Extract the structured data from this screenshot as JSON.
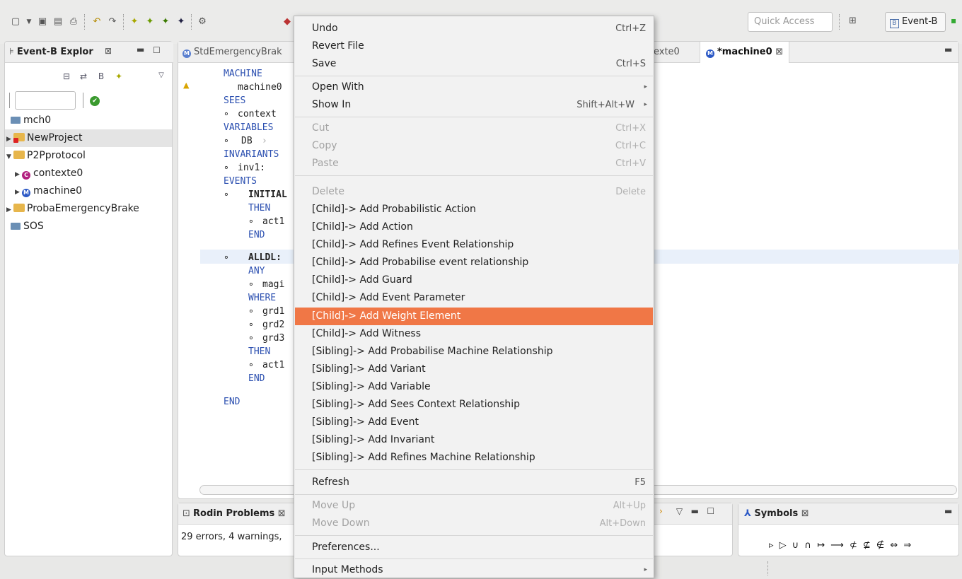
{
  "toolbar": {
    "quick_access_placeholder": "Quick Access",
    "perspective_label": "Event-B"
  },
  "explorer": {
    "title": "Event-B Explor",
    "close_glyph": "⊠",
    "tree": [
      {
        "label": "mch0",
        "type": "folder"
      },
      {
        "label": "NewProject",
        "type": "project"
      },
      {
        "label": "P2Pprotocol",
        "type": "project"
      },
      {
        "label": "contexte0",
        "type": "context"
      },
      {
        "label": "machine0",
        "type": "machine"
      },
      {
        "label": "ProbaEmergencyBrake",
        "type": "project"
      },
      {
        "label": "SOS",
        "type": "folder"
      }
    ]
  },
  "editor": {
    "tabs": [
      "StdEmergencyBrak",
      "exte0",
      "*machine0"
    ],
    "code": {
      "machine_kw": "MACHINE",
      "machine_name": "machine0",
      "sees_kw": "SEES",
      "sees_item": "context",
      "variables_kw": "VARIABLES",
      "variables_item": "DB",
      "invariants_kw": "INVARIANTS",
      "invariants_item": "inv1:",
      "events_kw": "EVENTS",
      "event1": "INITIAL",
      "then_kw": "THEN",
      "act1": "act1",
      "end_kw": "END",
      "event2": "ALLDL:",
      "any_kw": "ANY",
      "param1": "magi",
      "where_kw": "WHERE",
      "grd1": "grd1",
      "grd2": "grd2",
      "grd3": "grd3",
      "end_final": "END"
    }
  },
  "problems": {
    "title": "Rodin Problems",
    "status": "29 errors, 4 warnings,"
  },
  "symbols": {
    "title": "Symbols",
    "row": "▹ ▷ ∪ ∩ ↦ ⟶ ⊄ ⊈ ∉ ⇔ ⇒"
  },
  "context_menu": {
    "items": [
      {
        "label": "Undo",
        "shortcut": "Ctrl+Z",
        "enabled": true
      },
      {
        "label": "Revert File",
        "shortcut": "",
        "enabled": true
      },
      {
        "label": "Save",
        "shortcut": "Ctrl+S",
        "enabled": true
      },
      {
        "label": "Open With",
        "shortcut": "",
        "enabled": true,
        "submenu": true
      },
      {
        "label": "Show In",
        "shortcut": "Shift+Alt+W",
        "enabled": true,
        "submenu": true
      },
      {
        "label": "Cut",
        "shortcut": "Ctrl+X",
        "enabled": false
      },
      {
        "label": "Copy",
        "shortcut": "Ctrl+C",
        "enabled": false
      },
      {
        "label": "Paste",
        "shortcut": "Ctrl+V",
        "enabled": false
      },
      {
        "label": "Delete",
        "shortcut": "Delete",
        "enabled": false
      },
      {
        "label": "[Child]-> Add  Probabilistic Action",
        "enabled": true
      },
      {
        "label": "[Child]-> Add  Action",
        "enabled": true
      },
      {
        "label": "[Child]-> Add  Refines Event Relationship",
        "enabled": true
      },
      {
        "label": "[Child]-> Add  Probabilise event relationship",
        "enabled": true
      },
      {
        "label": "[Child]-> Add  Guard",
        "enabled": true
      },
      {
        "label": "[Child]-> Add  Event Parameter",
        "enabled": true
      },
      {
        "label": "[Child]-> Add  Weight Element",
        "enabled": true,
        "highlighted": true
      },
      {
        "label": "[Child]-> Add  Witness",
        "enabled": true
      },
      {
        "label": "[Sibling]-> Add  Probabilise Machine Relationship",
        "enabled": true
      },
      {
        "label": "[Sibling]-> Add  Variant",
        "enabled": true
      },
      {
        "label": "[Sibling]-> Add  Variable",
        "enabled": true
      },
      {
        "label": "[Sibling]-> Add  Sees Context Relationship",
        "enabled": true
      },
      {
        "label": "[Sibling]-> Add  Event",
        "enabled": true
      },
      {
        "label": "[Sibling]-> Add  Invariant",
        "enabled": true
      },
      {
        "label": "[Sibling]-> Add  Refines Machine Relationship",
        "enabled": true
      },
      {
        "label": "Refresh",
        "shortcut": "F5",
        "enabled": true
      },
      {
        "label": "Move Up",
        "shortcut": "Alt+Up",
        "enabled": false
      },
      {
        "label": "Move Down",
        "shortcut": "Alt+Down",
        "enabled": false
      },
      {
        "label": "Preferences...",
        "enabled": true
      },
      {
        "label": "Input Methods",
        "enabled": true,
        "submenu": true
      }
    ],
    "highlight_color": "#f07746"
  }
}
